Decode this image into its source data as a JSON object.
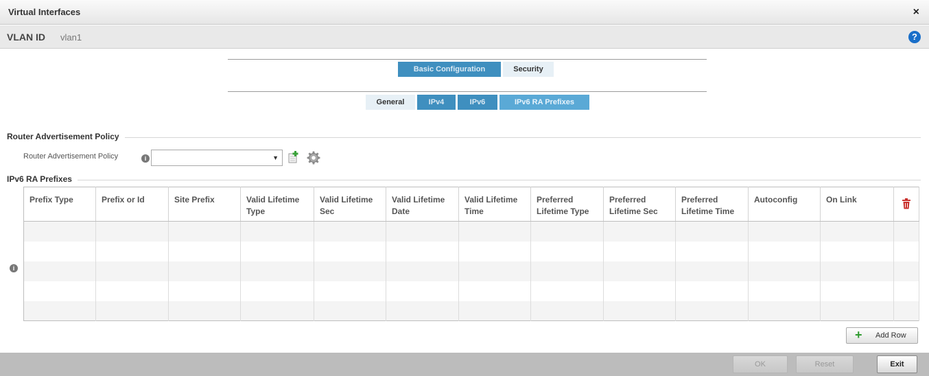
{
  "window": {
    "title": "Virtual Interfaces",
    "close_label": "×",
    "help_label": "?"
  },
  "vlan": {
    "label": "VLAN ID",
    "value": "vlan1"
  },
  "main_tabs": [
    {
      "label": "Basic Configuration",
      "active": true
    },
    {
      "label": "Security",
      "active": false
    }
  ],
  "sub_tabs": [
    {
      "label": "General",
      "active": false
    },
    {
      "label": "IPv4",
      "active": false
    },
    {
      "label": "IPv6",
      "active": false
    },
    {
      "label": "IPv6 RA Prefixes",
      "active": true
    }
  ],
  "ra_policy": {
    "section_title": "Router Advertisement Policy",
    "field_label": "Router Advertisement Policy",
    "selected_value": ""
  },
  "prefixes": {
    "section_title": "IPv6 RA Prefixes",
    "columns": [
      "Prefix Type",
      "Prefix or Id",
      "Site Prefix",
      "Valid Lifetime Type",
      "Valid Lifetime Sec",
      "Valid Lifetime Date",
      "Valid Lifetime Time",
      "Preferred Lifetime Type",
      "Preferred Lifetime Sec",
      "Preferred Lifetime Time",
      "Autoconfig",
      "On Link"
    ],
    "rows": []
  },
  "add_row_label": "Add Row",
  "footer": {
    "ok_label": "OK",
    "reset_label": "Reset",
    "exit_label": "Exit"
  },
  "colors": {
    "tab_blue": "#3f8fbf",
    "help_blue": "#1a6fc9",
    "delete_red": "#c9302c",
    "add_green": "#2e9a2e"
  }
}
